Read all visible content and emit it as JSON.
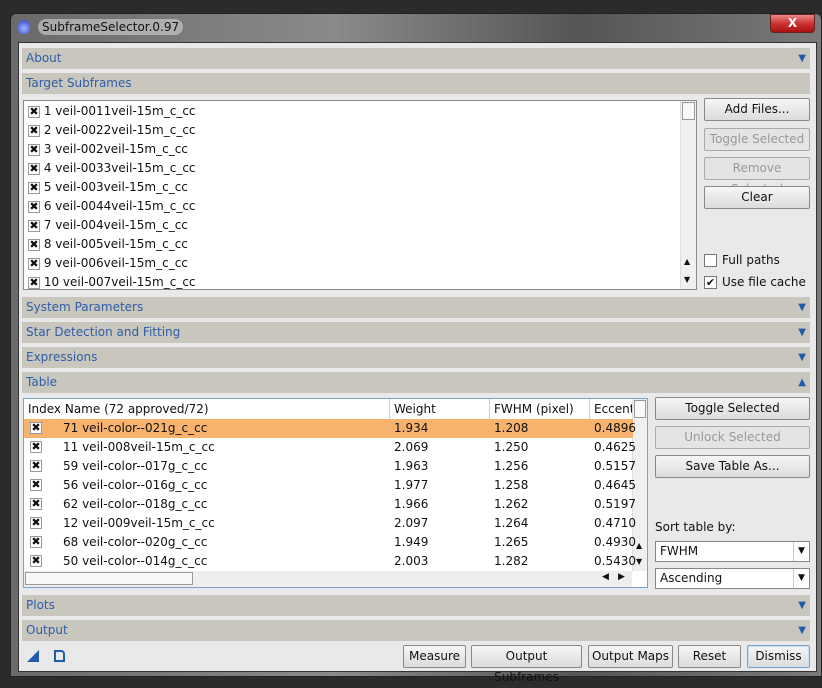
{
  "window": {
    "title": "SubframeSelector.0.97",
    "close": "X"
  },
  "sections": {
    "about": "About",
    "target": "Target Subframes",
    "system": "System Parameters",
    "star": "Star Detection and Fitting",
    "expressions": "Expressions",
    "table": "Table",
    "plots": "Plots",
    "output": "Output"
  },
  "target": {
    "files": [
      "1 veil-0011veil-15m_c_cc",
      "2 veil-0022veil-15m_c_cc",
      "3 veil-002veil-15m_c_cc",
      "4 veil-0033veil-15m_c_cc",
      "5 veil-003veil-15m_c_cc",
      "6 veil-0044veil-15m_c_cc",
      "7 veil-004veil-15m_c_cc",
      "8 veil-005veil-15m_c_cc",
      "9 veil-006veil-15m_c_cc",
      "10 veil-007veil-15m_c_cc"
    ],
    "buttons": {
      "add": "Add Files...",
      "toggle": "Toggle Selected",
      "remove": "Remove Selected",
      "clear": "Clear"
    },
    "full_paths": {
      "label": "Full paths",
      "checked": false
    },
    "use_cache": {
      "label": "Use file cache",
      "checked": true
    }
  },
  "table": {
    "headers": [
      "Index Name (72 approved/72)",
      "Weight",
      "FWHM (pixel)",
      "Eccentr"
    ],
    "rows": [
      {
        "name": "71 veil-color--021g_c_cc",
        "weight": "1.934",
        "fwhm": "1.208",
        "ecc": "0.4896",
        "selected": true
      },
      {
        "name": "11 veil-008veil-15m_c_cc",
        "weight": "2.069",
        "fwhm": "1.250",
        "ecc": "0.4625"
      },
      {
        "name": "59 veil-color--017g_c_cc",
        "weight": "1.963",
        "fwhm": "1.256",
        "ecc": "0.5157"
      },
      {
        "name": "56 veil-color--016g_c_cc",
        "weight": "1.977",
        "fwhm": "1.258",
        "ecc": "0.4645"
      },
      {
        "name": "62 veil-color--018g_c_cc",
        "weight": "1.966",
        "fwhm": "1.262",
        "ecc": "0.5197"
      },
      {
        "name": "12 veil-009veil-15m_c_cc",
        "weight": "2.097",
        "fwhm": "1.264",
        "ecc": "0.4710"
      },
      {
        "name": "68 veil-color--020g_c_cc",
        "weight": "1.949",
        "fwhm": "1.265",
        "ecc": "0.4930"
      },
      {
        "name": "50 veil-color--014g_c_cc",
        "weight": "2.003",
        "fwhm": "1.282",
        "ecc": "0.5430"
      }
    ],
    "buttons": {
      "toggle": "Toggle Selected",
      "unlock": "Unlock Selected",
      "save": "Save Table As..."
    },
    "sort_label": "Sort table by:",
    "sort_by": "FWHM",
    "sort_order": "Ascending"
  },
  "footer": {
    "measure": "Measure",
    "output_subframes": "Output Subframes",
    "output_maps": "Output Maps",
    "reset": "Reset",
    "dismiss": "Dismiss"
  },
  "colors": {
    "accent": "#2f5ea8",
    "selection": "#f7b26e",
    "section": "#c8c6bd"
  }
}
